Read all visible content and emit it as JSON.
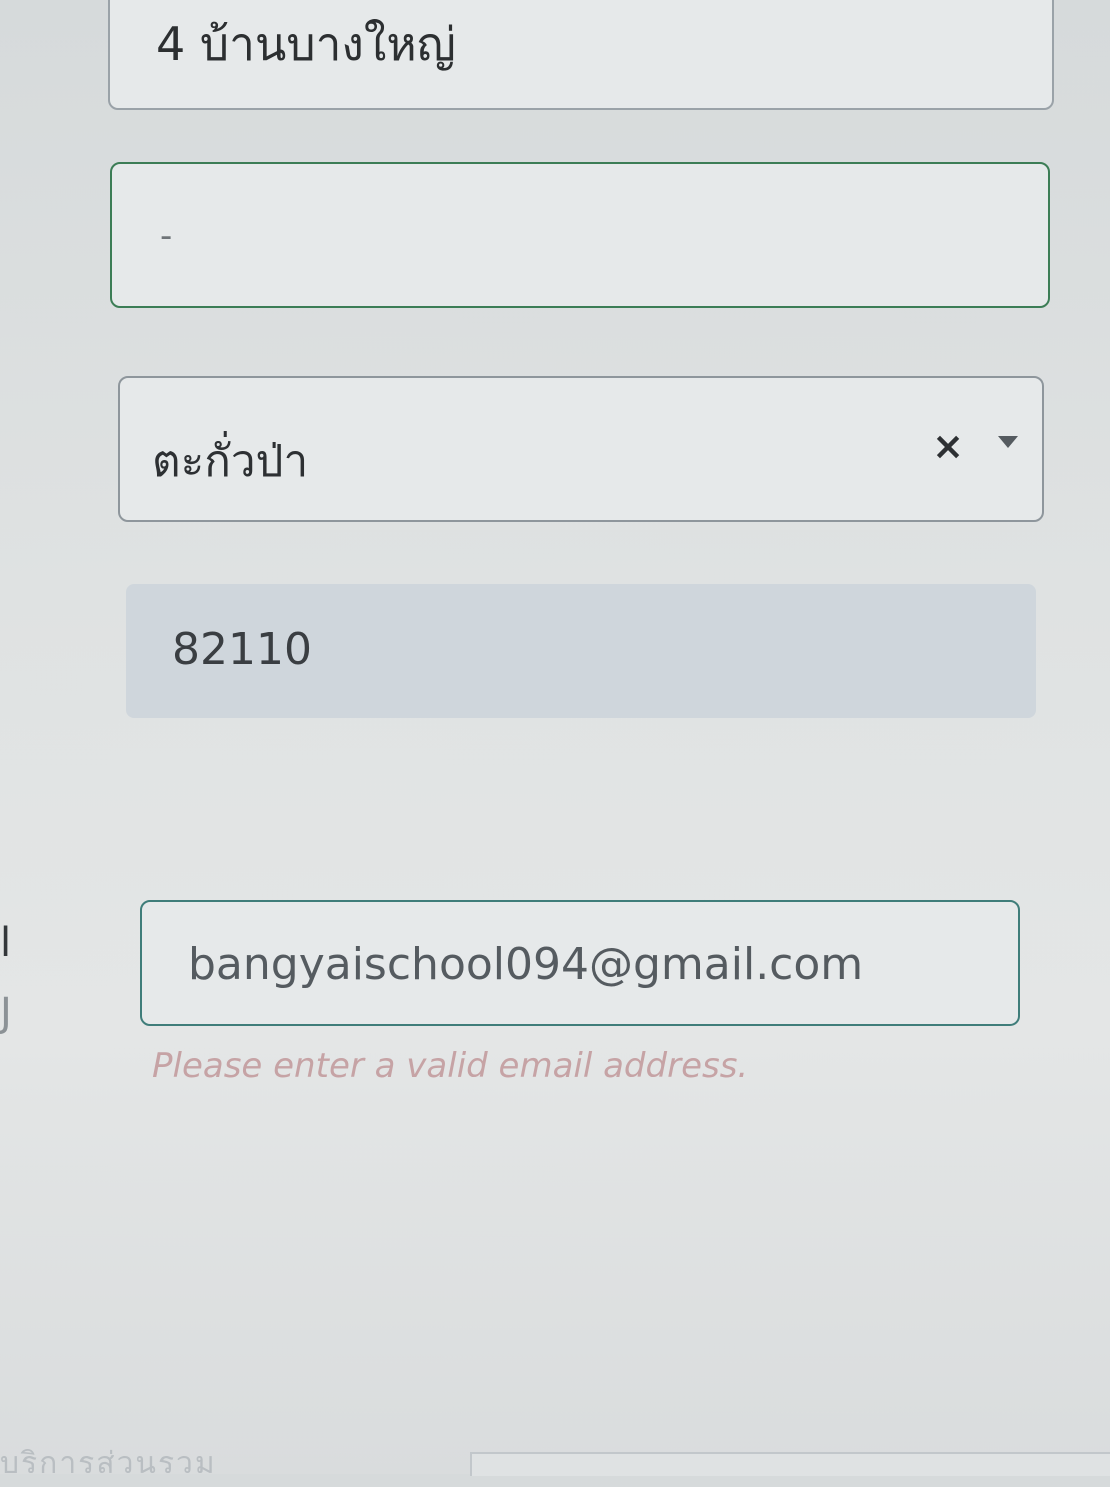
{
  "form": {
    "address": {
      "value": "4  บ้านบางใหญ่"
    },
    "road": {
      "value": "-"
    },
    "district": {
      "value": "ตะกั่วป่า",
      "clear_label": "×"
    },
    "postal_code": {
      "value": "82110"
    },
    "email": {
      "value": "bangyaischool094@gmail.com",
      "error": "Please enter a valid email address."
    }
  },
  "edge": {
    "mark1": "ี",
    "mark2": "l",
    "mark3": "J"
  },
  "footer": {
    "faint_text": "บริการส่วนรวม"
  },
  "colors": {
    "focus_border": "#3c7d56",
    "error_text": "#c6a3a5",
    "readonly_bg": "#cfd6dc"
  }
}
